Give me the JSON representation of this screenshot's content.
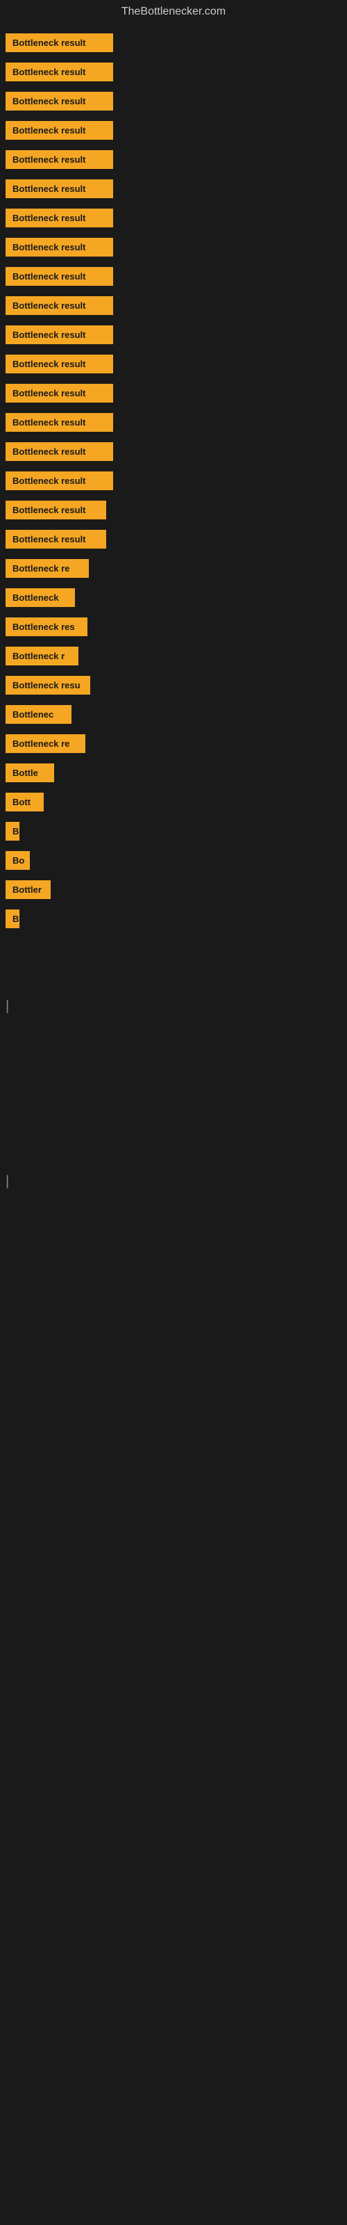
{
  "site": {
    "title": "TheBottlenecker.com"
  },
  "bars": [
    {
      "label": "Bottleneck result",
      "width": 155
    },
    {
      "label": "Bottleneck result",
      "width": 155
    },
    {
      "label": "Bottleneck result",
      "width": 155
    },
    {
      "label": "Bottleneck result",
      "width": 155
    },
    {
      "label": "Bottleneck result",
      "width": 155
    },
    {
      "label": "Bottleneck result",
      "width": 155
    },
    {
      "label": "Bottleneck result",
      "width": 155
    },
    {
      "label": "Bottleneck result",
      "width": 155
    },
    {
      "label": "Bottleneck result",
      "width": 155
    },
    {
      "label": "Bottleneck result",
      "width": 155
    },
    {
      "label": "Bottleneck result",
      "width": 155
    },
    {
      "label": "Bottleneck result",
      "width": 155
    },
    {
      "label": "Bottleneck result",
      "width": 155
    },
    {
      "label": "Bottleneck result",
      "width": 155
    },
    {
      "label": "Bottleneck result",
      "width": 155
    },
    {
      "label": "Bottleneck result",
      "width": 155
    },
    {
      "label": "Bottleneck result",
      "width": 145
    },
    {
      "label": "Bottleneck result",
      "width": 145
    },
    {
      "label": "Bottleneck re",
      "width": 120
    },
    {
      "label": "Bottleneck",
      "width": 100
    },
    {
      "label": "Bottleneck res",
      "width": 118
    },
    {
      "label": "Bottleneck r",
      "width": 105
    },
    {
      "label": "Bottleneck resu",
      "width": 122
    },
    {
      "label": "Bottlenec",
      "width": 95
    },
    {
      "label": "Bottleneck re",
      "width": 115
    },
    {
      "label": "Bottle",
      "width": 70
    },
    {
      "label": "Bott",
      "width": 55
    },
    {
      "label": "B",
      "width": 20
    },
    {
      "label": "Bo",
      "width": 35
    },
    {
      "label": "Bottler",
      "width": 65
    },
    {
      "label": "B",
      "width": 18
    },
    {
      "label": "",
      "width": 0
    },
    {
      "label": "",
      "width": 0
    },
    {
      "label": "|",
      "width": 10
    },
    {
      "label": "",
      "width": 0
    },
    {
      "label": "",
      "width": 0
    },
    {
      "label": "",
      "width": 0
    },
    {
      "label": "",
      "width": 0
    },
    {
      "label": "",
      "width": 0
    },
    {
      "label": "|",
      "width": 10
    }
  ]
}
